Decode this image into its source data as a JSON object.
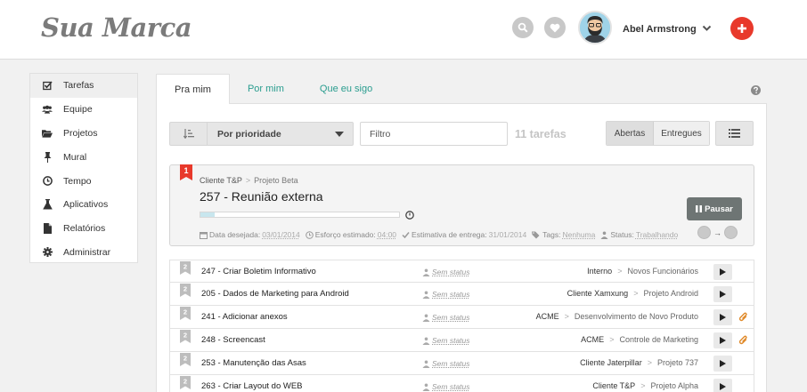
{
  "brand": {
    "logo_text": "Sua Marca"
  },
  "header": {
    "user_name": "Abel Armstrong",
    "icons": [
      "search-icon",
      "heart-icon",
      "chevron-down-icon",
      "plus-icon"
    ],
    "accent_color": "#e8392b"
  },
  "sidebar": {
    "items": [
      {
        "label": "Tarefas",
        "icon": "check-square-icon",
        "active": true
      },
      {
        "label": "Equipe",
        "icon": "users-icon"
      },
      {
        "label": "Projetos",
        "icon": "folder-icon"
      },
      {
        "label": "Mural",
        "icon": "pin-icon"
      },
      {
        "label": "Tempo",
        "icon": "clock-icon"
      },
      {
        "label": "Aplicativos",
        "icon": "flask-icon"
      },
      {
        "label": "Relatórios",
        "icon": "file-icon"
      },
      {
        "label": "Administrar",
        "icon": "gear-icon"
      }
    ]
  },
  "tabs": [
    {
      "label": "Pra mim",
      "active": true
    },
    {
      "label": "Por mim"
    },
    {
      "label": "Que eu sigo"
    }
  ],
  "toolbar": {
    "sort_label": "Por prioridade",
    "filter_placeholder": "Filtro",
    "count_label": "11 tarefas",
    "seg_open": "Abertas",
    "seg_delivered": "Entregues"
  },
  "featured": {
    "priority": "1",
    "client": "Cliente T&P",
    "crumb_sep": ">",
    "project": "Projeto Beta",
    "title": "257 - Reunião externa",
    "progress": 0.07,
    "pause_label": "Pausar",
    "meta": {
      "date_label": "Data desejada:",
      "date_value": "03/01/2014",
      "effort_label": "Esforço estimado:",
      "effort_value": "04:00",
      "delivery_label": "Estimativa de entrega:",
      "delivery_value": "31/01/2014",
      "tags_label": "Tags:",
      "tags_value": "Nenhuma",
      "status_label": "Status:",
      "status_value": "Trabalhando"
    },
    "handoff_arrow": "→"
  },
  "tasks": [
    {
      "priority": "2",
      "title": "247 - Criar Boletim Informativo",
      "status": "Sem status",
      "client": "Interno",
      "project": "Novos Funcionários",
      "attachment": false
    },
    {
      "priority": "2",
      "title": "205 - Dados de Marketing para Android",
      "status": "Sem status",
      "client": "Cliente Xamxung",
      "project": "Projeto Android",
      "attachment": false
    },
    {
      "priority": "2",
      "title": "241 - Adicionar anexos",
      "status": "Sem status",
      "client": "ACME",
      "project": "Desenvolvimento de Novo Produto",
      "attachment": true
    },
    {
      "priority": "2",
      "title": "248 - Screencast",
      "status": "Sem status",
      "client": "ACME",
      "project": "Controle de Marketing",
      "attachment": true
    },
    {
      "priority": "2",
      "title": "253 - Manutenção das Asas",
      "status": "Sem status",
      "client": "Cliente Jaterpillar",
      "project": "Projeto 737",
      "attachment": false
    },
    {
      "priority": "2",
      "title": "263 - Criar Layout do WEB",
      "status": "Sem status",
      "client": "Cliente T&P",
      "project": "Projeto Alpha",
      "attachment": false
    }
  ]
}
